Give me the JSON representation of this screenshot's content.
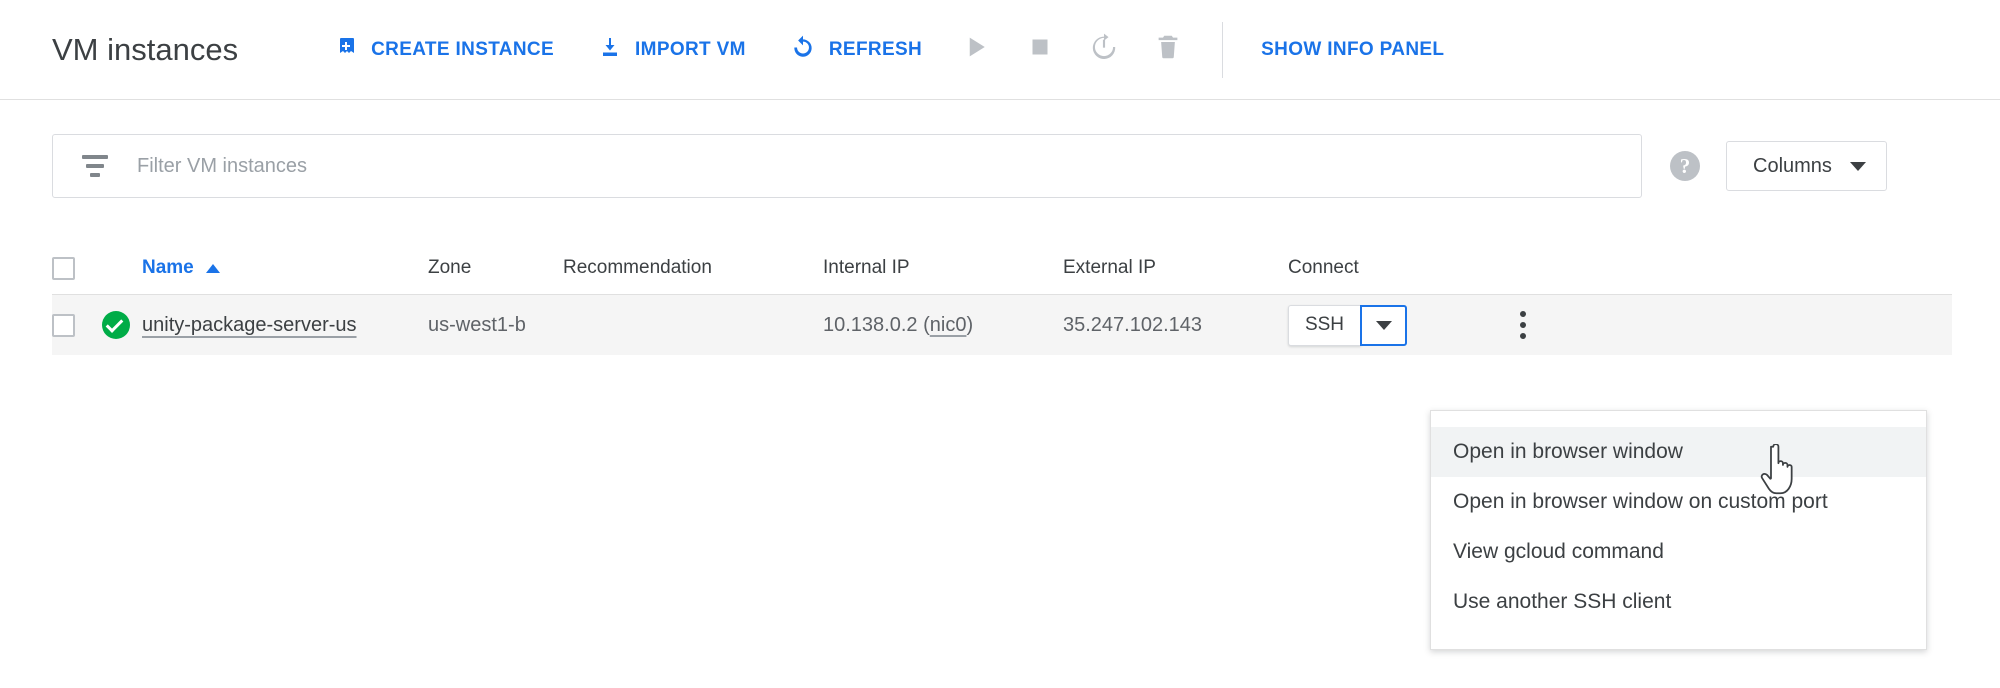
{
  "header": {
    "title": "VM instances",
    "actions": [
      {
        "label": "CREATE INSTANCE",
        "icon": "add-instance-icon"
      },
      {
        "label": "IMPORT VM",
        "icon": "import-download-icon"
      },
      {
        "label": "REFRESH",
        "icon": "refresh-icon"
      }
    ],
    "icon_buttons": [
      {
        "name": "start-play-icon"
      },
      {
        "name": "stop-square-icon"
      },
      {
        "name": "reset-power-icon"
      },
      {
        "name": "delete-trash-icon"
      }
    ],
    "show_info_panel": "SHOW INFO PANEL"
  },
  "filter": {
    "placeholder": "Filter VM instances",
    "value": "",
    "icon": "filter-lines-icon",
    "help_icon": "help-question-icon",
    "help_glyph": "?",
    "columns_label": "Columns"
  },
  "table": {
    "columns": [
      "Name",
      "Zone",
      "Recommendation",
      "Internal IP",
      "External IP",
      "Connect"
    ],
    "sort_column": "Name",
    "sort_direction": "ascending",
    "rows": [
      {
        "selected": false,
        "status": "running",
        "name": "unity-package-server-us",
        "zone": "us-west1-b",
        "recommendation": "",
        "internal_ip": "10.138.0.2",
        "internal_nic": "nic0",
        "external_ip": "35.247.102.143",
        "connect_label": "SSH"
      }
    ]
  },
  "ssh_menu": {
    "open": true,
    "items": [
      {
        "label": "Open in browser window",
        "hovered": true
      },
      {
        "label": "Open in browser window on custom port",
        "hovered": false
      },
      {
        "label": "View gcloud command",
        "hovered": false
      },
      {
        "label": "Use another SSH client",
        "hovered": false
      }
    ]
  },
  "colors": {
    "accent_blue": "#1a73e8",
    "status_green": "#00ac47",
    "text_primary": "#3c4043",
    "text_secondary": "#5f6368",
    "border": "#dadce0",
    "row_background": "#f5f5f5",
    "menu_hover": "#f1f3f4"
  }
}
